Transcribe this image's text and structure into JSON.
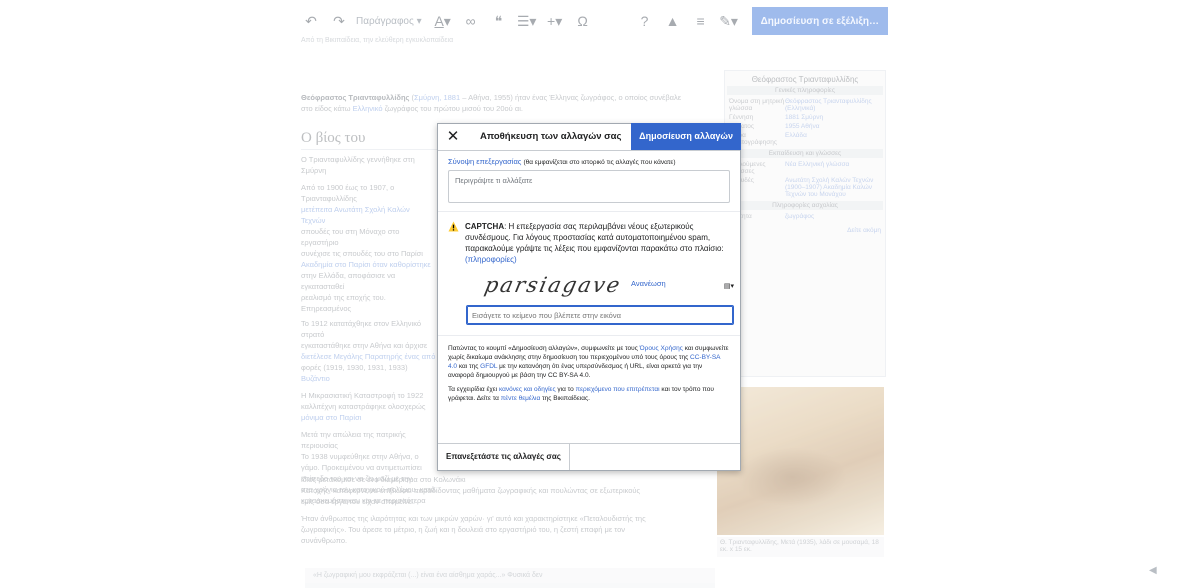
{
  "toolbar": {
    "undo_icon": "undo-icon",
    "redo_icon": "redo-icon",
    "paragraph_label": "Παράγραφος",
    "publish_label": "Δημοσίευση σε εξέλιξη…",
    "help_glyph": "?",
    "notice_glyph": "▲",
    "menu_glyph": "≡"
  },
  "background": {
    "notice": "Από τη Βικιπαίδεια, την ελεύθερη εγκυκλοπαίδεια",
    "intro_bold": "Θεόφραστος Τριανταφυλλίδης",
    "intro_link1": "Σμύρνη, 1881",
    "intro_text1": "– Αθήνα, 1955) ήταν ένας Έλληνας ζωγράφος, ο οποίος συνέβαλε",
    "intro_text2": "στο είδος κάτω",
    "intro_link2": "Ελληνικό",
    "intro_text3": "ζωγράφος του πρώτου μισού του 20ού αι.",
    "heading": "Ο βίος του",
    "p1": "Ο Τριανταφυλλίδης γεννήθηκε στη Σμύρνη",
    "p2": "Από το 1900 έως το 1907, ο Τριανταφυλλίδης",
    "p3": "μετέπειτα Ανωτάτη Σχολή Καλών Τεχνών",
    "p4": "σπουδές του στη Μόναχο στο εργαστήριο",
    "p5": "συνέχισε τις σπουδές του στο Παρίσι",
    "p6": "Ακαδημία στο Παρίσι όταν καθορίστηκε",
    "p7": "στην Ελλάδα, αποφάσισε να εγκατασταθεί",
    "p8": "ρεαλισμό της εποχής του. Επηρεασμένος",
    "p9": "Το 1912 κατατάχθηκε στον Ελληνικό στρατό",
    "p10": "εγκαταστάθηκε στην Αθήνα και άρχισε",
    "p11": "διετέλεσε Μεγάλης Παρατηρής ένας από",
    "p12": "φορές (1919, 1930, 1931, 1933)",
    "p13": "Βυζάντιο",
    "p14": "Η Μικρασιατική Καταστροφή το 1922",
    "p15": "καλλιτέχνη καταστράφηκε ολοσχερώς",
    "p16": "μόνιμα στο Παρίσι",
    "p17": "Μετά την απώλεια της πατρικής περιουσίας",
    "p18": "Το 1938 νυμφεύθηκε στην Αθήνα, ο",
    "p19": "γάμο. Προκειμένου να αντιμετωπίσει",
    "p20": "επίπεδο του και να ζει μαζί με την",
    "p21": "στα χρόνια του κατοχικού πολέμου, κατά",
    "p22": "κατασκευάστηκαν και τα περισσότερα",
    "p23": "ίδιος μετακόμισε σε ένα διαμέρισμα στο Κολωνάκι",
    "p24": "Κατοχής, κατάφερνε να επιβιώσει παραδίδοντας μαθήματα ζωγραφικής και πουλώντας σε εξωτερικούς",
    "p25": "εμίς όσα έργα του είχαν απομείνει.",
    "p26": "Ήταν άνθρωπος της ιλαρότητας και των μικρών χαρών· γι' αυτό και χαρακτηρίστηκε «Πεταλουδιστής της",
    "p27": "ζωγραφικής». Του άρεσε το μέτριο, η ζωή και η δουλειά στο εργαστήριό του, η ζεστή επαφή με τον",
    "p28": "συνάνθρωπο.",
    "quote": "«Η ζωγραφική μου εκφράζεται (...) είναι ένα αίσθημα χαράς...» Φυσικά δεν",
    "caption": "Θ. Τριανταφυλλίδης, Μετά (1935), λάδι σε μουσαμά, 18 εκ. x 15 εκ."
  },
  "infobox": {
    "title": "Θεόφραστος Τριανταφυλλίδης",
    "section1": "Γενικές πληροφορίες",
    "rows": [
      {
        "k": "Όνομα στη μητρική γλώσσα",
        "v": "Θεόφραστος Τριανταφυλλίδης (Ελληνικά)"
      },
      {
        "k": "Γέννηση",
        "v": "1881 Σμύρνη"
      },
      {
        "k": "Θάνατος",
        "v": "1955 Αθήνα"
      },
      {
        "k": "Χώρα πολιτογράφησης",
        "v": "Ελλάδα"
      }
    ],
    "section2": "Εκπαίδευση και γλώσσες",
    "rows2": [
      {
        "k": "Ομιλούμενες γλώσσες",
        "v": "Νέα Ελληνική γλώσσα"
      },
      {
        "k": "Σπουδές",
        "v": "Ανωτάτη Σχολή Καλών Τεχνών (1900–1907) Ακαδημία Καλών Τεχνών του Μονάχου"
      }
    ],
    "section3": "Πληροφορίες ασχολίας",
    "rows3": [
      {
        "k": "Ιδιότητα",
        "v": "ζωγράφος"
      }
    ],
    "footer_link": "Δείτε ακόμη"
  },
  "dialog": {
    "close_glyph": "✕",
    "title": "Αποθήκευση των αλλαγών σας",
    "publish_label": "Δημοσίευση αλλαγών",
    "summary_link": "Σύνοψη επεξεργασίας",
    "summary_hint": "(θα εμφανίζεται στο ιστορικό τις αλλαγές που κάνατε)",
    "summary_placeholder": "Περιγράψτε τι αλλάξατε",
    "captcha_title": "CAPTCHA",
    "captcha_text": ": Η επεξεργασία σας περιλαμβάνει νέους εξωτερικούς συνδέσμους. Για λόγους προστασίας κατά αυτοματοποιημένου spam, παρακαλούμε γράψτε τις λέξεις που εμφανίζονται παρακάτω στο πλαίσιο:",
    "captcha_more": "(πληροφορίες)",
    "captcha_word": "parsiagave",
    "refresh_label": "Ανανέωση",
    "audio_glyph": "▤▾",
    "captcha_placeholder": "Εισάγετε το κείμενο που βλέπετε στην εικόνα",
    "terms1_a": "Πατώντας το κουμπί «Δημοσίευση αλλαγών», συμφωνείτε με τους",
    "terms1_link1": "Όρους Χρήσης",
    "terms1_b": "και συμφωνείτε χωρίς δικαίωμα ανάκλησης στην δημοσίευση του περιεχομένου υπό τους όρους της",
    "terms1_link2": "CC-BY-SA 4.0",
    "terms1_c": "και της",
    "terms1_link3": "GFDL",
    "terms1_d": "με την κατανόηση ότι ένας υπερσύνδεσμος ή URL, είναι αρκετά για την αναφορά δημιουργού με βάση την CC BY-SA 4.0.",
    "terms2_a": "Τα εγχειρίδια έχει",
    "terms2_link1": "κανόνες και οδηγίες",
    "terms2_b": "για το",
    "terms2_link2": "περιεχόμενο που επιτρέπεται",
    "terms2_c": "και τον τρόπο που γράφεται. Δείτε τα",
    "terms2_link3": "πέντε θεμέλια",
    "terms2_d": "της Βικιπαίδειας.",
    "review_label": "Επανεξετάστε τις αλλαγές σας"
  },
  "colors": {
    "accent": "#3366cc",
    "warning": "#fc3"
  }
}
